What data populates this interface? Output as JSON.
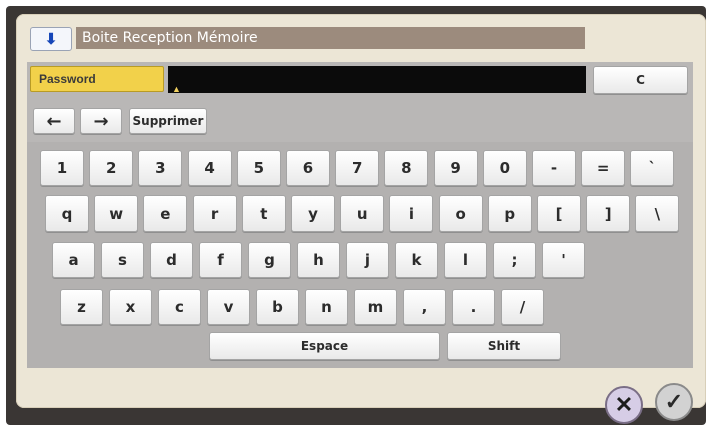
{
  "window": {
    "title": "Boite Reception Mémoire",
    "title_icon": "inbox-arrow-icon"
  },
  "password": {
    "label": "Password",
    "value": "",
    "clear_label": "C"
  },
  "nav": {
    "left": "←",
    "right": "→",
    "delete_label": "Supprimer"
  },
  "keys": {
    "row1": [
      "1",
      "2",
      "3",
      "4",
      "5",
      "6",
      "7",
      "8",
      "9",
      "0",
      "-",
      "=",
      "`"
    ],
    "row2": [
      "q",
      "w",
      "e",
      "r",
      "t",
      "y",
      "u",
      "i",
      "o",
      "p",
      "[",
      "]",
      "\\"
    ],
    "row3": [
      "a",
      "s",
      "d",
      "f",
      "g",
      "h",
      "j",
      "k",
      "l",
      ";",
      "'"
    ],
    "row4": [
      "z",
      "x",
      "c",
      "v",
      "b",
      "n",
      "m",
      ",",
      ".",
      "/"
    ],
    "space_label": "Espace",
    "shift_label": "Shift"
  },
  "actions": {
    "cancel_label": "✕",
    "ok_label": "✓"
  }
}
